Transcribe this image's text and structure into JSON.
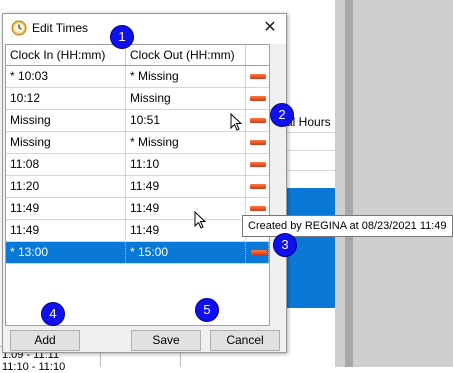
{
  "dialog": {
    "title": "Edit Times",
    "close_glyph": "✕",
    "columns": [
      "Clock In (HH:mm)",
      "Clock Out (HH:mm)",
      ""
    ],
    "rows": [
      {
        "clock_in": "* 10:03",
        "clock_out": "* Missing",
        "selected": false
      },
      {
        "clock_in": "10:12",
        "clock_out": "Missing",
        "selected": false
      },
      {
        "clock_in": "Missing",
        "clock_out": "10:51",
        "selected": false
      },
      {
        "clock_in": "Missing",
        "clock_out": "* Missing",
        "selected": false
      },
      {
        "clock_in": "11:08",
        "clock_out": "11:10",
        "selected": false
      },
      {
        "clock_in": "11:20",
        "clock_out": "11:49",
        "selected": false
      },
      {
        "clock_in": "11:49",
        "clock_out": "11:49",
        "selected": false
      },
      {
        "clock_in": "11:49",
        "clock_out": "11:49",
        "selected": false
      },
      {
        "clock_in": "* 13:00",
        "clock_out": "* 15:00",
        "selected": true
      }
    ],
    "buttons": {
      "add": "Add",
      "save": "Save",
      "cancel": "Cancel"
    }
  },
  "tooltip": "Created by REGINA at 08/23/2021 11:49",
  "background": {
    "column_header": "al Hours",
    "bottom_rows": [
      "1:09 - 11:11",
      "11:10 - 11:10"
    ]
  },
  "callouts": [
    "1",
    "2",
    "3",
    "4",
    "5"
  ],
  "colors": {
    "selection": "#0a78d6",
    "callout": "#1010ee",
    "delete_icon": "#e0461a"
  },
  "icons": {
    "title": "clock-icon",
    "row_action": "delete-row-icon",
    "pointer": "mouse-pointer-icon"
  }
}
